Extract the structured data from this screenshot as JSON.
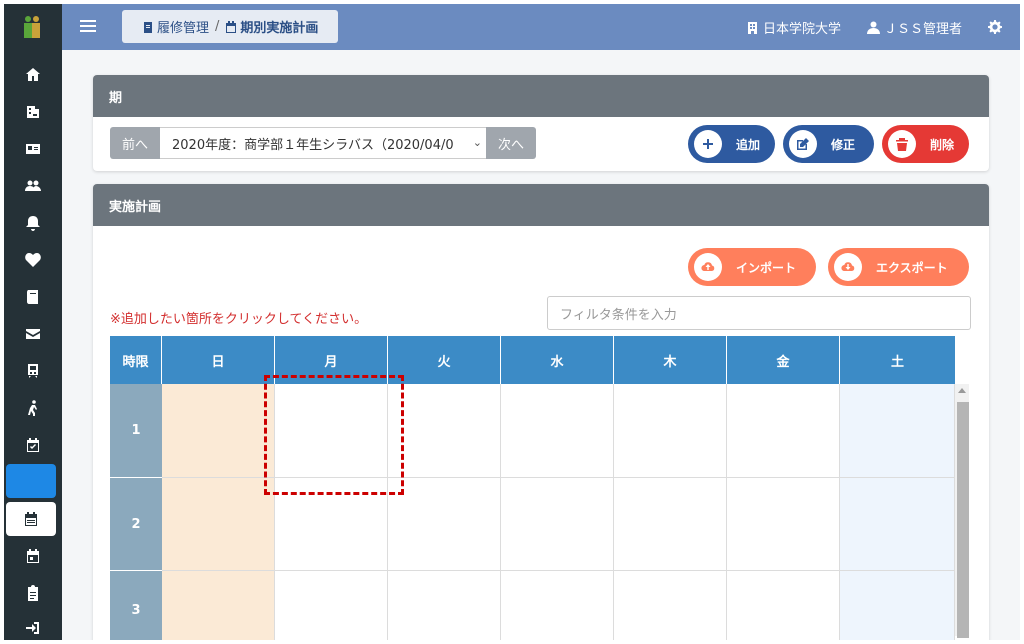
{
  "header": {
    "breadcrumb": {
      "parent": "履修管理",
      "separator": "/",
      "current": "期別実施計画"
    },
    "university": "日本学院大学",
    "user": "ＪＳＳ管理者"
  },
  "sidebar": {
    "icons": [
      "home-icon",
      "building-icon",
      "id-card-icon",
      "users-icon",
      "bell-icon",
      "heartbeat-icon",
      "book-icon",
      "envelope-icon",
      "train-icon",
      "walking-icon",
      "calendar-check-icon",
      "calendar-alt-icon",
      "calendar-icon",
      "clipboard-icon",
      "sign-in-icon"
    ]
  },
  "period_panel": {
    "title": "期",
    "prev_label": "前へ",
    "next_label": "次へ",
    "selected_period": "2020年度：商学部１年生シラバス（2020/04/0",
    "add_label": "追加",
    "edit_label": "修正",
    "delete_label": "削除"
  },
  "plan_panel": {
    "title": "実施計画",
    "import_label": "インポート",
    "export_label": "エクスポート",
    "hint": "※追加したい箇所をクリックしてください。",
    "filter_placeholder": "フィルタ条件を入力",
    "headers": [
      "時限",
      "日",
      "月",
      "火",
      "水",
      "木",
      "金",
      "土"
    ],
    "periods": [
      "1",
      "2",
      "3"
    ]
  },
  "colors": {
    "header_bg": "#6b8bc0",
    "sidebar_bg": "#253137",
    "table_header": "#3c8bc6",
    "btn_navy": "#2e5aa0",
    "btn_red": "#e53935",
    "btn_orange": "#ff7f5c",
    "sunday_bg": "#fbead6",
    "saturday_bg": "#eef5fd"
  }
}
